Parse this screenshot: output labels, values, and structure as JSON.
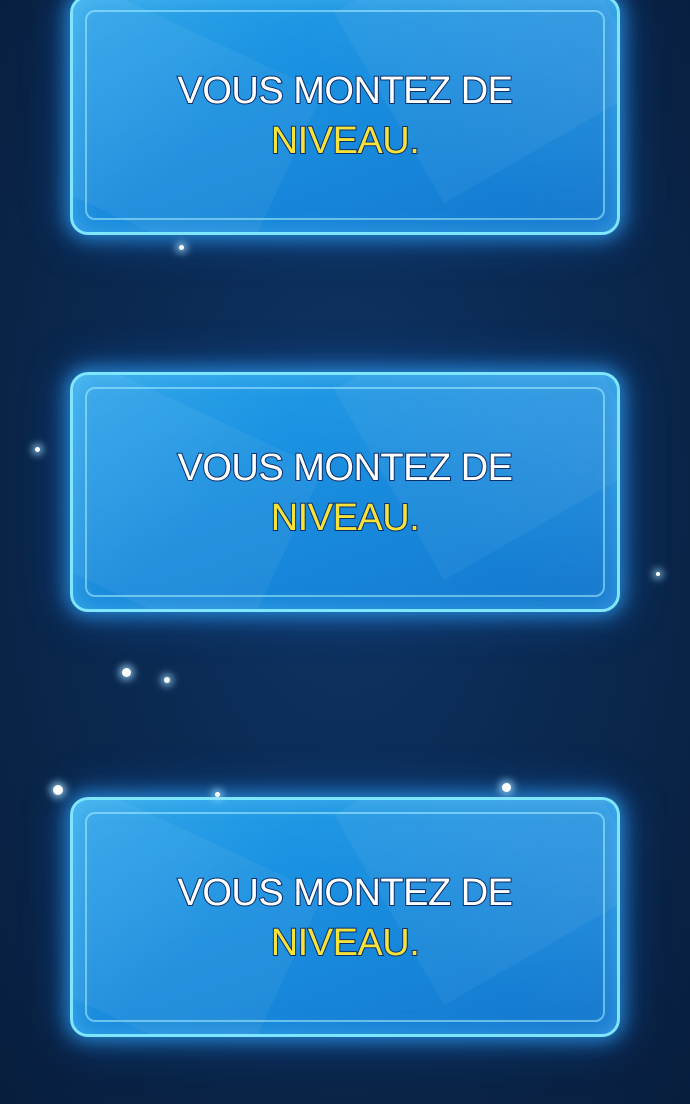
{
  "panels": [
    {
      "line1": "VOUS MONTEZ DE",
      "line2": "NIVEAU."
    },
    {
      "line1": "VOUS MONTEZ DE",
      "line2": "NIVEAU."
    },
    {
      "line1": "VOUS MONTEZ DE",
      "line2": "NIVEAU."
    }
  ],
  "colors": {
    "background": "#0b2a52",
    "panel": "#1a8fe0",
    "panel_border": "#7fe6ff",
    "text_primary": "#ffffff",
    "text_highlight": "#f7e23a"
  }
}
